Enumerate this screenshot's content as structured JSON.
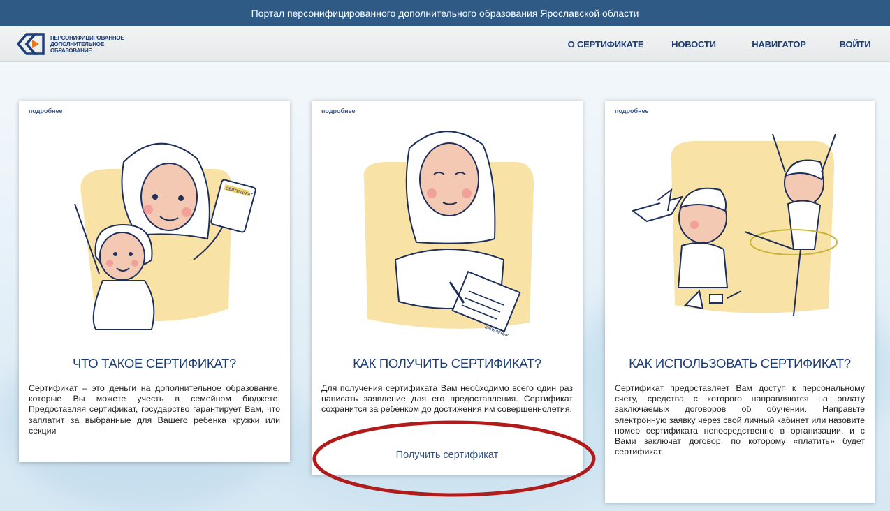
{
  "topbar": {
    "title": "Портал персонифицированного дополнительного образования Ярославской области"
  },
  "logo": {
    "line1": "ПЕРСОНИФИЦИРОВАННОЕ",
    "line2": "ДОПОЛНИТЕЛЬНОЕ",
    "line3": "ОБРАЗОВАНИЕ",
    "icon": "logo-mark-icon"
  },
  "nav": {
    "items": [
      {
        "label": "О СЕРТИФИКАТЕ"
      },
      {
        "label": "НОВОСТИ"
      },
      {
        "label": "НАВИГАТОР"
      },
      {
        "label": "ВОЙТИ"
      }
    ]
  },
  "cards": [
    {
      "more": "подробнее",
      "title": "ЧТО ТАКОЕ СЕРТИФИКАТ?",
      "text": "Сертификат – это деньги на дополнительное образование, которые Вы можете учесть в семейном бюджете. Предоставляя сертификат, государство гарантирует Вам, что заплатит за выбранные для Вашего ребенка кружки или секции",
      "illustration": "mother-and-child-illustration",
      "cert_label": "СЕРТИФИКАТ"
    },
    {
      "more": "подробнее",
      "title": "КАК ПОЛУЧИТЬ СЕРТИФИКАТ?",
      "text": "Для получения сертификата Вам необходимо всего один раз написать заявление для его предоставления. Сертификат сохранится за ребенком до достижения им совершеннолетия.",
      "link": "Получить сертификат",
      "illustration": "woman-writing-application-illustration",
      "doc_label": "ЗАЯВЛЕНИЕ"
    },
    {
      "more": "подробнее",
      "title": "КАК ИСПОЛЬЗОВАТЬ СЕРТИФИКАТ?",
      "text": "Сертификат предоставляет Вам доступ к персональному счету, средства с которого направляются на оплату заключаемых договоров об обучении. Направьте электронную заявку через свой личный кабинет или назовите номер сертификата непосредственно в организации, и с Вами заключат договор, по которому «платить» будет сертификат.",
      "illustration": "children-activities-illustration"
    }
  ],
  "colors": {
    "topbar": "#2e5a85",
    "nav_text": "#1d3e7a",
    "title_text": "#1f3f74",
    "accent_yellow": "#f8e2a6",
    "annotation_red": "#b01c1c"
  }
}
